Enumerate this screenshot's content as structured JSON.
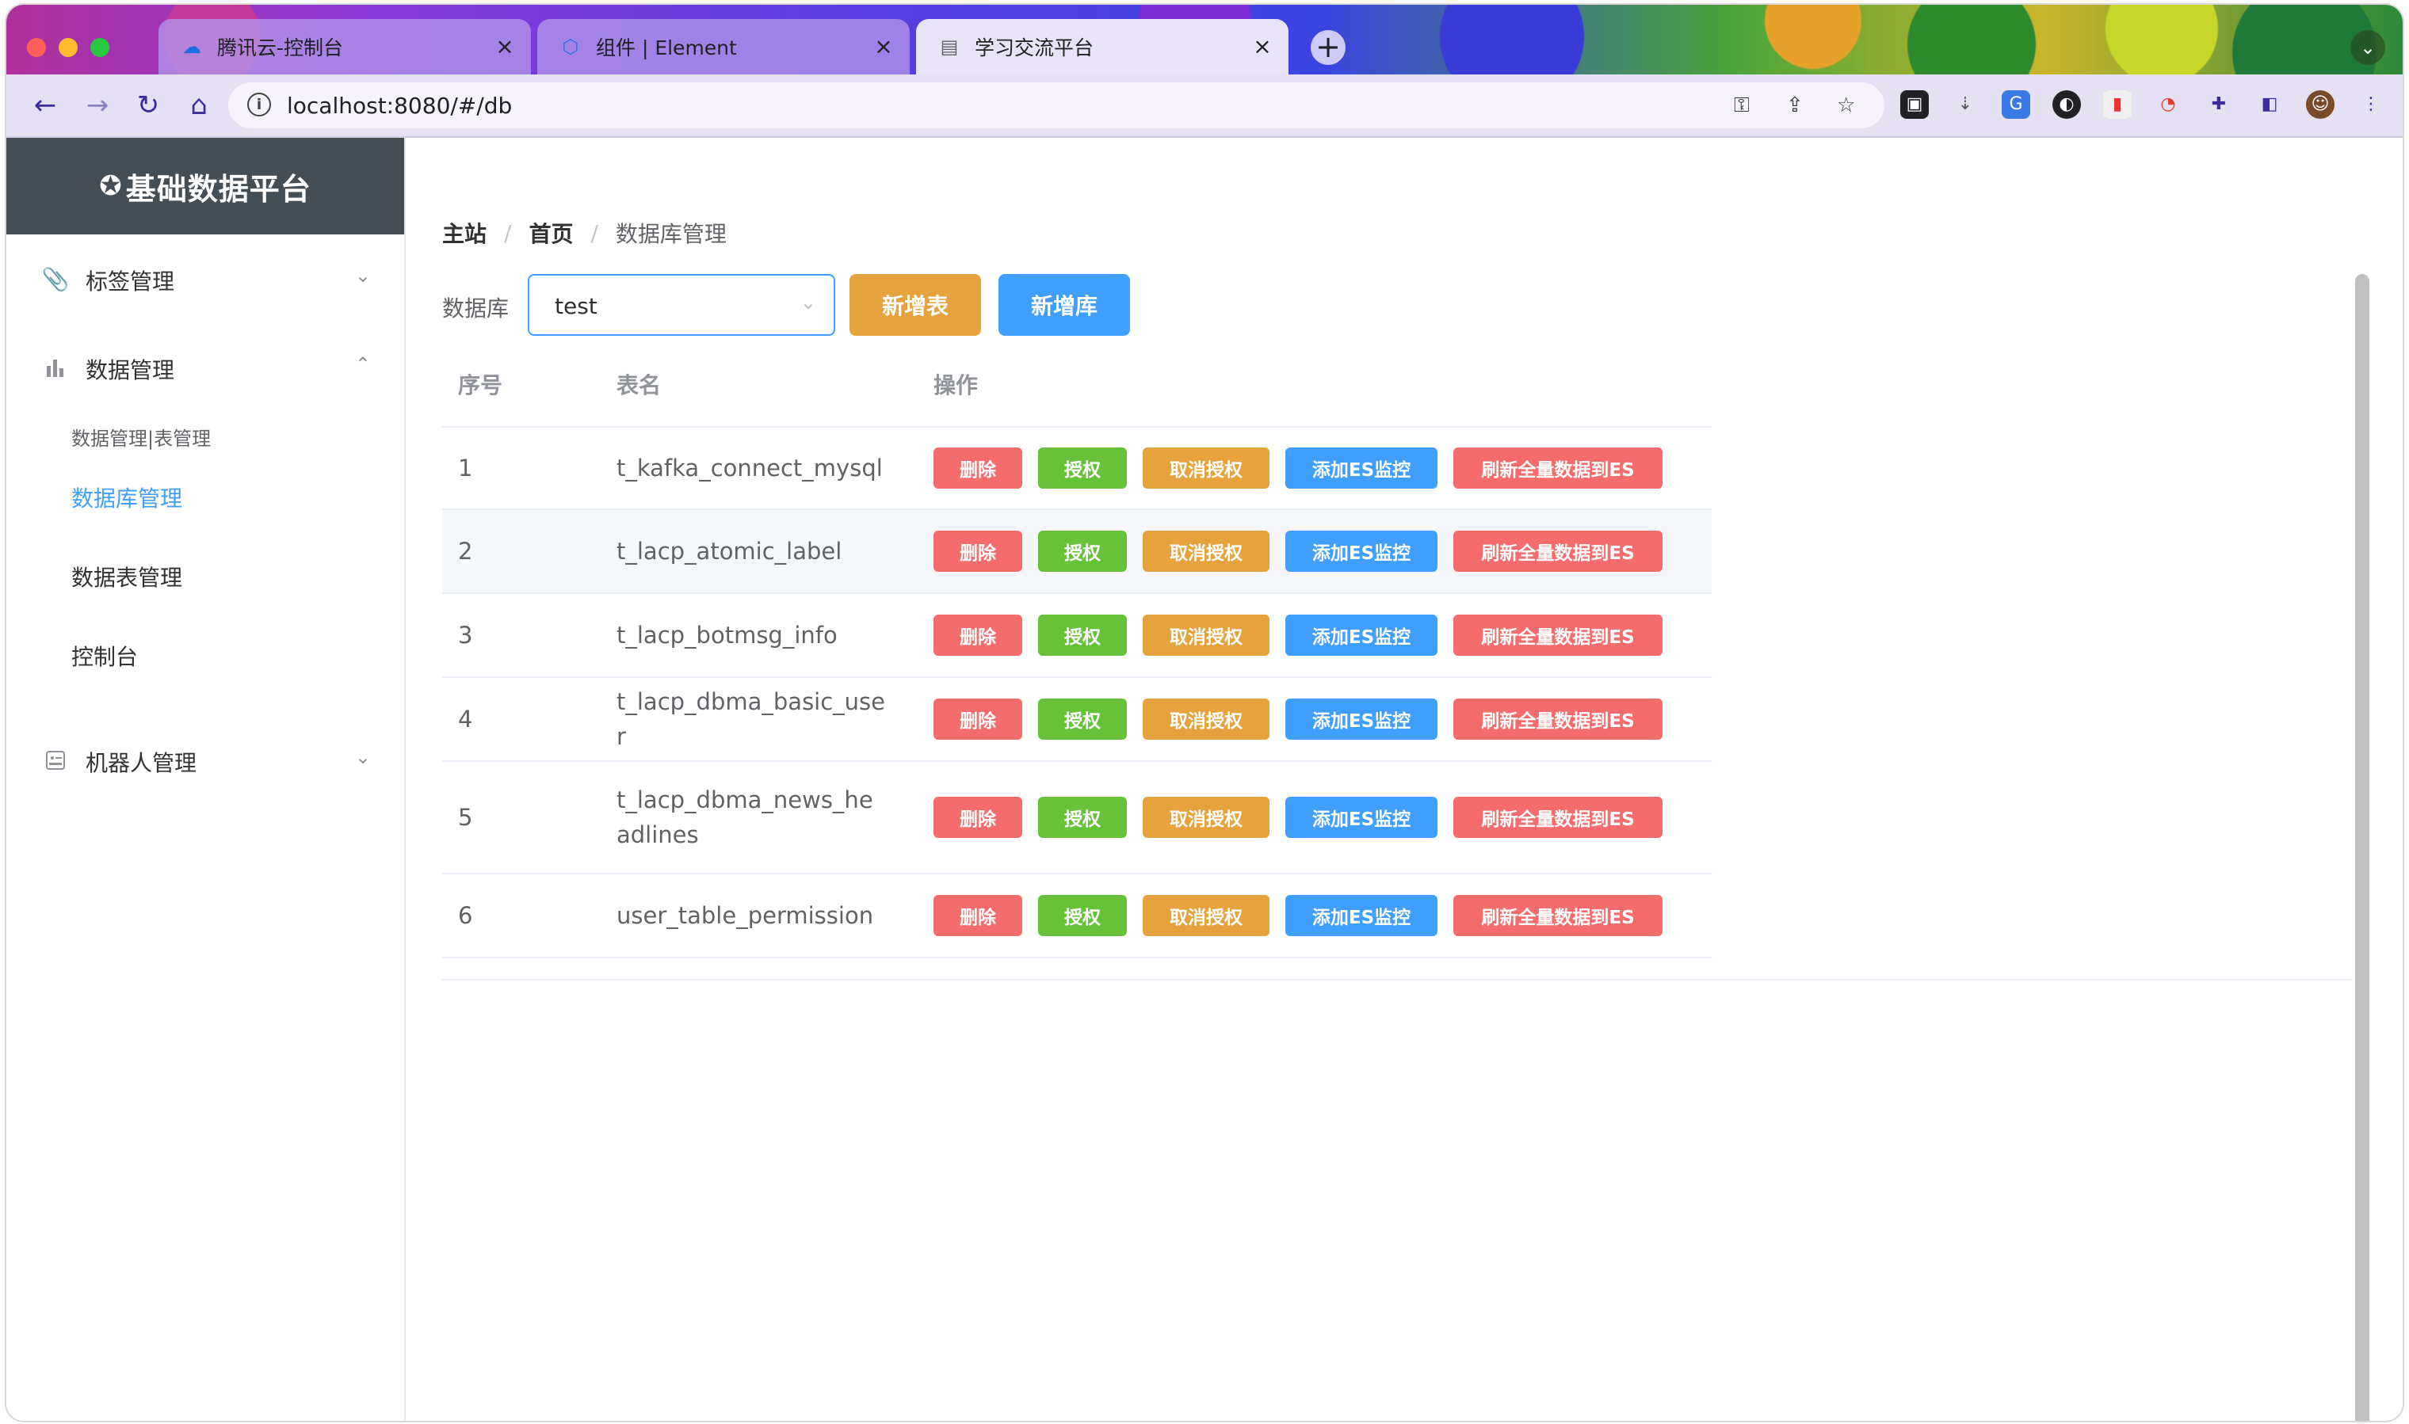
{
  "browser": {
    "tabs": [
      {
        "title": "腾讯云-控制台",
        "icon": "cloud-icon"
      },
      {
        "title": "组件 | Element",
        "icon": "element-icon"
      },
      {
        "title": "学习交流平台",
        "icon": "page-icon"
      }
    ],
    "url": "localhost:8080/#/db"
  },
  "sidebar": {
    "logo": "基础数据平台",
    "menu": [
      {
        "label": "标签管理",
        "icon": "paperclip-icon"
      },
      {
        "label": "数据管理",
        "icon": "bar-chart-icon"
      },
      {
        "label": "机器人管理",
        "icon": "robot-icon"
      }
    ],
    "submenu": [
      {
        "label": "数据管理|表管理"
      },
      {
        "label": "数据库管理"
      },
      {
        "label": "数据表管理"
      },
      {
        "label": "控制台"
      }
    ]
  },
  "breadcrumb": [
    "主站",
    "首页",
    "数据库管理"
  ],
  "filter": {
    "label": "数据库",
    "selected": "test"
  },
  "actions": {
    "add_table": "新增表",
    "add_db": "新增库"
  },
  "table": {
    "headers": [
      "序号",
      "表名",
      "操作"
    ],
    "op_labels": {
      "delete": "删除",
      "grant": "授权",
      "revoke": "取消授权",
      "add_es": "添加ES监控",
      "refresh_es": "刷新全量数据到ES"
    },
    "rows": [
      {
        "idx": "1",
        "name": "t_kafka_connect_mysql"
      },
      {
        "idx": "2",
        "name": "t_lacp_atomic_label"
      },
      {
        "idx": "3",
        "name": "t_lacp_botmsg_info"
      },
      {
        "idx": "4",
        "name": "t_lacp_dbma_basic_user"
      },
      {
        "idx": "5",
        "name": "t_lacp_dbma_news_headlines"
      },
      {
        "idx": "6",
        "name": "user_table_permission"
      }
    ]
  },
  "colors": {
    "primary": "#409eff",
    "danger": "#f56c6c",
    "success": "#67c23a",
    "warning": "#e6a23c",
    "logo_bg": "#454d55"
  }
}
